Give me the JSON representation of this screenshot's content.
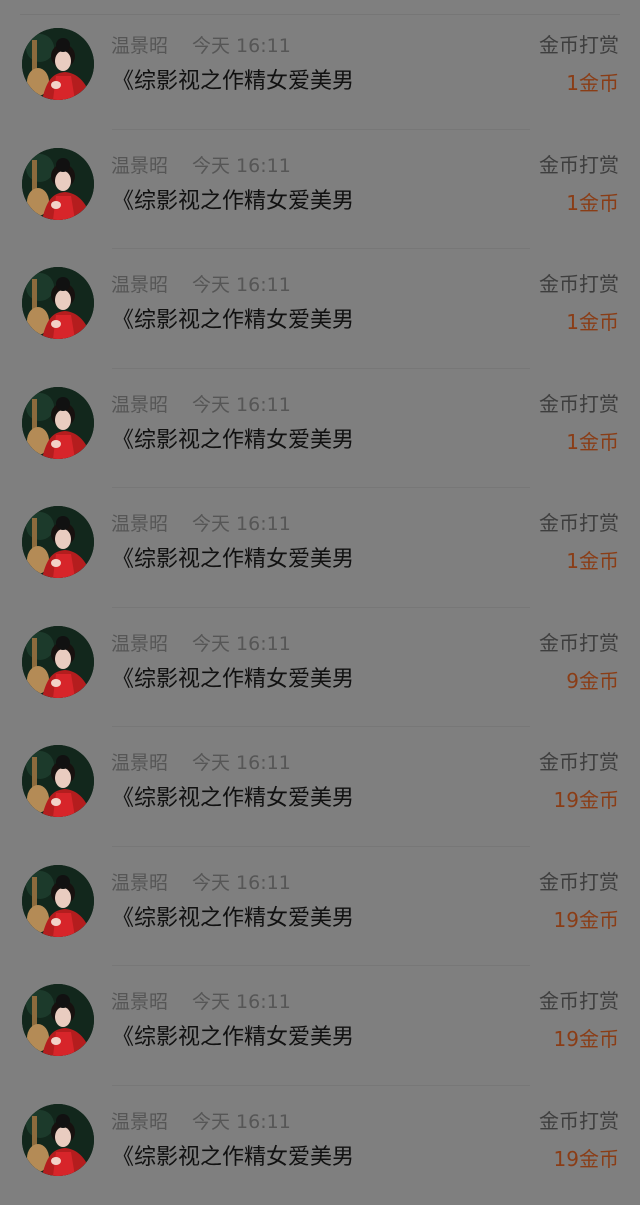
{
  "colors": {
    "page_bg": "#7f7f7f",
    "muted_text": "#565656",
    "title_text": "#111111",
    "reward_text": "#8a3d16"
  },
  "records": [
    {
      "user_name": "温景昭",
      "time": "今天 16:11",
      "book_title": "《综影视之作精女爱美男",
      "reward_type": "金币打赏",
      "amount": "1金币",
      "avatar_icon": "user-avatar-icon"
    },
    {
      "user_name": "温景昭",
      "time": "今天 16:11",
      "book_title": "《综影视之作精女爱美男",
      "reward_type": "金币打赏",
      "amount": "1金币",
      "avatar_icon": "user-avatar-icon"
    },
    {
      "user_name": "温景昭",
      "time": "今天 16:11",
      "book_title": "《综影视之作精女爱美男",
      "reward_type": "金币打赏",
      "amount": "1金币",
      "avatar_icon": "user-avatar-icon"
    },
    {
      "user_name": "温景昭",
      "time": "今天 16:11",
      "book_title": "《综影视之作精女爱美男",
      "reward_type": "金币打赏",
      "amount": "1金币",
      "avatar_icon": "user-avatar-icon"
    },
    {
      "user_name": "温景昭",
      "time": "今天 16:11",
      "book_title": "《综影视之作精女爱美男",
      "reward_type": "金币打赏",
      "amount": "1金币",
      "avatar_icon": "user-avatar-icon"
    },
    {
      "user_name": "温景昭",
      "time": "今天 16:11",
      "book_title": "《综影视之作精女爱美男",
      "reward_type": "金币打赏",
      "amount": "9金币",
      "avatar_icon": "user-avatar-icon"
    },
    {
      "user_name": "温景昭",
      "time": "今天 16:11",
      "book_title": "《综影视之作精女爱美男",
      "reward_type": "金币打赏",
      "amount": "19金币",
      "avatar_icon": "user-avatar-icon"
    },
    {
      "user_name": "温景昭",
      "time": "今天 16:11",
      "book_title": "《综影视之作精女爱美男",
      "reward_type": "金币打赏",
      "amount": "19金币",
      "avatar_icon": "user-avatar-icon"
    },
    {
      "user_name": "温景昭",
      "time": "今天 16:11",
      "book_title": "《综影视之作精女爱美男",
      "reward_type": "金币打赏",
      "amount": "19金币",
      "avatar_icon": "user-avatar-icon"
    },
    {
      "user_name": "温景昭",
      "time": "今天 16:11",
      "book_title": "《综影视之作精女爱美男",
      "reward_type": "金币打赏",
      "amount": "19金币",
      "avatar_icon": "user-avatar-icon"
    }
  ]
}
